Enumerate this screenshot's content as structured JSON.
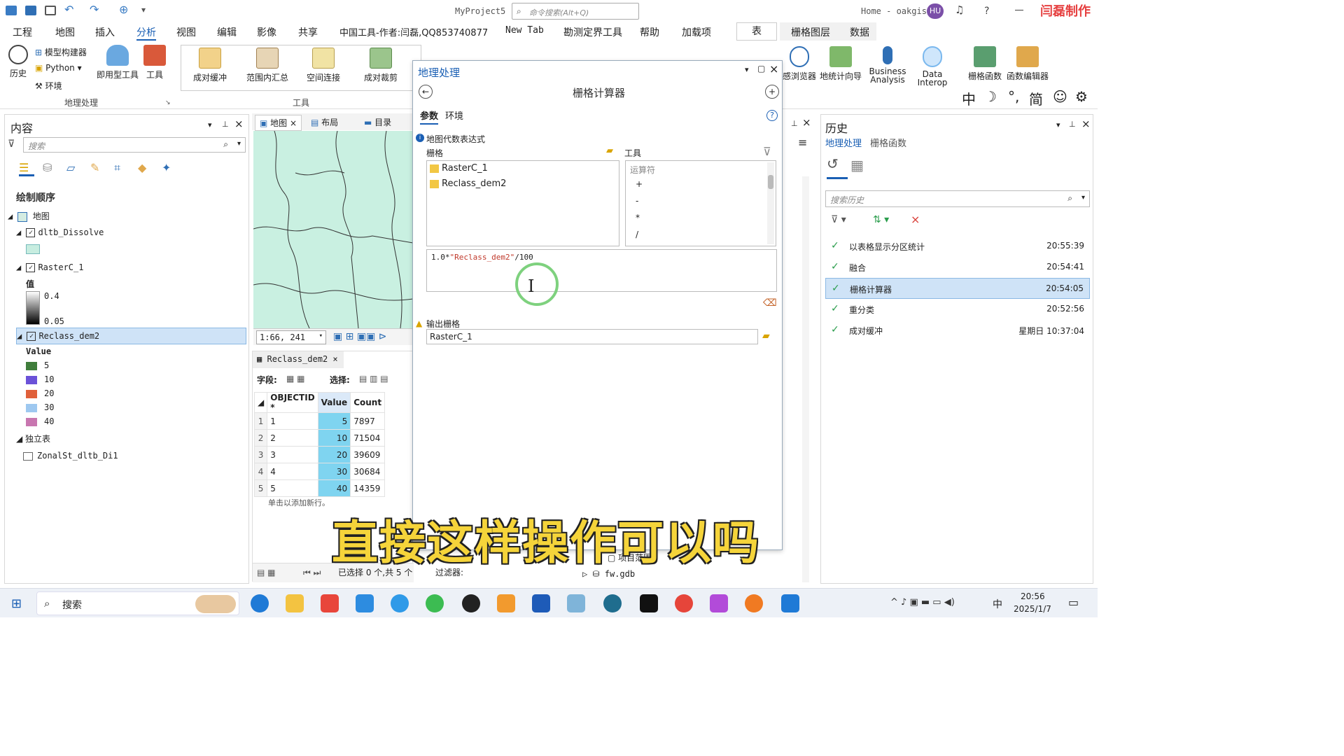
{
  "app": {
    "project_name": "MyProject5",
    "command_search_placeholder": "命令搜索(Alt+Q)",
    "user_label": "Home - oakgis",
    "user_initials": "HU",
    "help": "?",
    "watermark": "闫磊制作"
  },
  "ribbon": {
    "tabs": [
      "工程",
      "地图",
      "插入",
      "分析",
      "视图",
      "编辑",
      "影像",
      "共享",
      "中国工具-作者:闫磊,QQ853740877",
      "New Tab",
      "勘测定界工具",
      "帮助",
      "加载项",
      "表",
      "栅格图层",
      "数据"
    ],
    "active_tab": "分析",
    "geoprocessing_group": {
      "label": "地理处理",
      "history": "历史",
      "model_builder": "模型构建器",
      "python": "Python",
      "environments": "环境",
      "ready_tools": "即用型工具",
      "tools": "工具"
    },
    "tools_group": {
      "label": "工具",
      "items": [
        "成对缓冲",
        "范围内汇总",
        "空间连接",
        "成对裁剪"
      ]
    },
    "right_items": [
      "感浏览器",
      "地统计向导",
      "Business Analysis",
      "Data Interop",
      "栅格函数",
      "函数编辑器"
    ],
    "ime": [
      "中",
      "☽",
      "°,",
      "简",
      "☺",
      "⚙"
    ]
  },
  "contents": {
    "title": "内容",
    "search_placeholder": "搜索",
    "drawing_order": "绘制顺序",
    "map_label": "地图",
    "layers": [
      {
        "name": "dltb_Dissolve"
      },
      {
        "name": "RasterC_1",
        "legend_title": "值",
        "high": "0.4",
        "low": "0.05"
      },
      {
        "name": "Reclass_dem2",
        "legend_title": "Value"
      }
    ],
    "reclass_legend": [
      {
        "label": "5",
        "color": "#3f7d3b"
      },
      {
        "label": "10",
        "color": "#6b52d8"
      },
      {
        "label": "20",
        "color": "#e0603a"
      },
      {
        "label": "30",
        "color": "#9ec8f0"
      },
      {
        "label": "40",
        "color": "#c876b0"
      }
    ],
    "standalone_tables": "独立表",
    "table_name": "ZonalSt_dltb_Di1"
  },
  "map_view": {
    "tabs": [
      "地图",
      "布局",
      "目录"
    ],
    "scale": "1:66, 241"
  },
  "attribute_table": {
    "tab_label": "Reclass_dem2",
    "fields_label": "字段:",
    "select_label": "选择:",
    "columns": [
      "OBJECTID *",
      "Value",
      "Count"
    ],
    "rows": [
      [
        "1",
        "1",
        "5",
        "7897"
      ],
      [
        "2",
        "2",
        "10",
        "71504"
      ],
      [
        "3",
        "3",
        "20",
        "39609"
      ],
      [
        "4",
        "4",
        "30",
        "30684"
      ],
      [
        "5",
        "5",
        "40",
        "14359"
      ]
    ],
    "add_row_hint": "单击以添加新行。",
    "status": "已选择 0 个,共 5 个",
    "filter_label": "过滤器:"
  },
  "geoprocessing": {
    "title": "地理处理",
    "tool_title": "栅格计算器",
    "tabs": [
      "参数",
      "环境"
    ],
    "expression_label": "地图代数表达式",
    "raster_label": "栅格",
    "tools_label": "工具",
    "rasters": [
      "RasterC_1",
      "Reclass_dem2"
    ],
    "operators_header": "运算符",
    "operators": [
      "+",
      "-",
      "*",
      "/"
    ],
    "expression_prefix": "1.0*",
    "expression_raster": "\"Reclass_dem2\"",
    "expression_suffix": "/100",
    "output_label": "输出栅格",
    "output_value": "RasterC_1"
  },
  "catalog_items": [
    "项目范围",
    "fw.gdb"
  ],
  "history": {
    "title": "历史",
    "tabs": [
      "地理处理",
      "栅格函数"
    ],
    "search_placeholder": "搜索历史",
    "entries": [
      {
        "name": "以表格显示分区统计",
        "time": "20:55:39"
      },
      {
        "name": "融合",
        "time": "20:54:41"
      },
      {
        "name": "栅格计算器",
        "time": "20:54:05"
      },
      {
        "name": "重分类",
        "time": "20:52:56"
      },
      {
        "name": "成对缓冲",
        "time": "星期日 10:37:04"
      }
    ]
  },
  "subtitle": "直接这样操作可以吗",
  "taskbar": {
    "search": "搜索",
    "time": "20:56",
    "date": "2025/1/7",
    "ime": "中"
  }
}
